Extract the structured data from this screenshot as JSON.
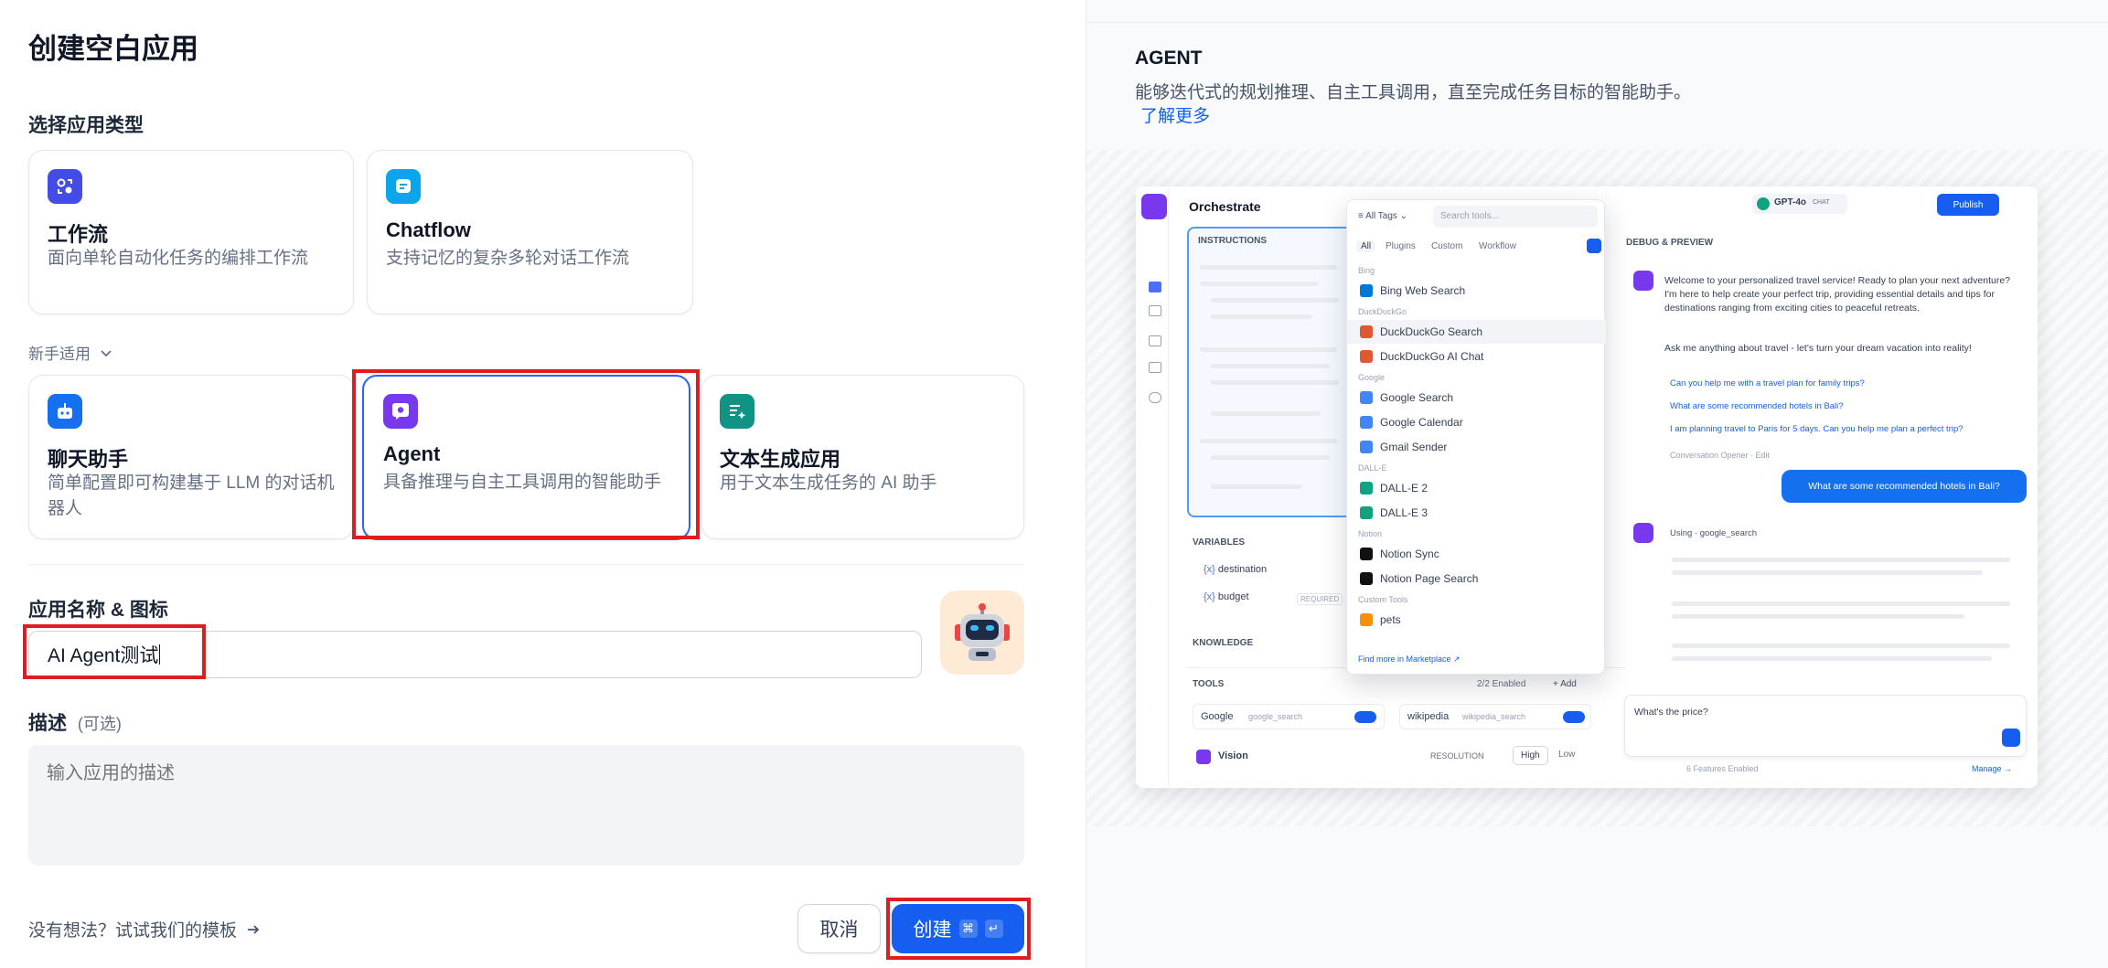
{
  "page": {
    "title": "创建空白应用"
  },
  "app_type": {
    "section_label": "选择应用类型",
    "cards": [
      {
        "title": "工作流",
        "desc": "面向单轮自动化任务的编排工作流"
      },
      {
        "title": "Chatflow",
        "desc": "支持记忆的复杂多轮对话工作流"
      }
    ],
    "beginner_toggle": "新手适用",
    "beginner_cards": [
      {
        "title": "聊天助手",
        "desc": "简单配置即可构建基于 LLM 的对话机器人"
      },
      {
        "title": "Agent",
        "desc": "具备推理与自主工具调用的智能助手"
      },
      {
        "title": "文本生成应用",
        "desc": "用于文本生成任务的 AI 助手"
      }
    ]
  },
  "name_icon": {
    "label": "应用名称 & 图标",
    "value": "AI Agent测试"
  },
  "description": {
    "label": "描述",
    "optional": "(可选)",
    "placeholder": "输入应用的描述"
  },
  "footer": {
    "template_link": "没有想法？试试我们的模板",
    "cancel": "取消",
    "create": "创建",
    "kbd": [
      "⌘",
      "↵"
    ]
  },
  "preview": {
    "heading": "AGENT",
    "desc": "能够迭代式的规划推理、自主工具调用，直至完成任务目标的智能助手。",
    "learn_more": "了解更多",
    "shot": {
      "orchestrate": "Orchestrate",
      "model": "GPT-4o",
      "model_tag": "CHAT",
      "publish": "Publish",
      "instructions": "INSTRUCTIONS",
      "variables": "VARIABLES",
      "vars": [
        {
          "name": "destination",
          "tag": ""
        },
        {
          "name": "budget",
          "tag": "REQUIRED"
        }
      ],
      "knowledge": "KNOWLEDGE",
      "tools": "TOOLS",
      "tools_enabled": "2/2 Enabled",
      "add": "+ Add",
      "tool_items": [
        {
          "name": "Google",
          "id": "google_search"
        },
        {
          "name": "wikipedia",
          "id": "wikipedia_search"
        }
      ],
      "vision": "Vision",
      "resolution": "RESOLUTION",
      "res_high": "High",
      "res_low": "Low",
      "dropdown": {
        "tags": "All Tags",
        "search": "Search tools...",
        "tabs": [
          "All",
          "Plugins",
          "Custom",
          "Workflow"
        ],
        "groups": [
          {
            "name": "Bing",
            "items": [
              "Bing Web Search"
            ]
          },
          {
            "name": "DuckDuckGo",
            "items": [
              "DuckDuckGo Search",
              "DuckDuckGo AI Chat"
            ]
          },
          {
            "name": "Google",
            "items": [
              "Google Search",
              "Google Calendar",
              "Gmail Sender"
            ]
          },
          {
            "name": "DALL-E",
            "items": [
              "DALL-E 2",
              "DALL-E 3"
            ]
          },
          {
            "name": "Notion",
            "items": [
              "Notion Sync",
              "Notion Page Search"
            ]
          },
          {
            "name": "Custom Tools",
            "items": [
              "pets"
            ]
          }
        ],
        "marketplace": "Find more in Marketplace ↗"
      },
      "debug": "DEBUG & PREVIEW",
      "welcome": "Welcome to your personalized travel service! Ready to plan your next adventure? I'm here to help create your perfect trip, providing essential details and tips for destinations ranging from exciting cities to peaceful retreats.",
      "ask": "Ask me anything about travel - let's turn your dream vacation into reality!",
      "suggestions": [
        "Can you help me with a travel plan for family trips?",
        "What are some recommended hotels in Bali?",
        "I am planning travel to Paris for 5 days. Can you help me plan a perfect trip?"
      ],
      "opener": "Conversation Opener · Edit",
      "user_msg": "What are some recommended hotels in Bali?",
      "using": "Using",
      "using_tool": "google_search",
      "input": "What's the price?",
      "features": "6 Features Enabled",
      "manage": "Manage →"
    }
  },
  "colors": {
    "primary": "#155eef",
    "highlight": "#e11b22",
    "workflow": "#444ce7",
    "chatflow": "#0ba5ec",
    "chatbot": "#1570ef",
    "agent": "#7839ee",
    "textgen": "#0e9384"
  }
}
